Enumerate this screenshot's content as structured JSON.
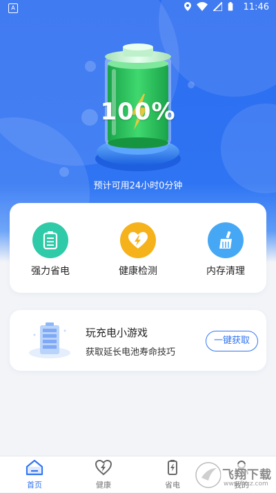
{
  "status_bar": {
    "time": "11:46",
    "left_icon": "A"
  },
  "battery": {
    "percent_text": "100%",
    "level": 100
  },
  "estimate": "预计可用24小时0分钟",
  "features": [
    {
      "label": "强力省电",
      "icon": "battery-save-icon",
      "color": "#2fcaa8"
    },
    {
      "label": "健康检测",
      "icon": "heart-bolt-icon",
      "color": "#f5b21b"
    },
    {
      "label": "内存清理",
      "icon": "broom-icon",
      "color": "#46a8f5"
    }
  ],
  "game": {
    "title": "玩充电小游戏",
    "subtitle": "获取延长电池寿命技巧",
    "button": "一键获取"
  },
  "tabs": [
    {
      "label": "首页",
      "icon": "home-icon",
      "active": true
    },
    {
      "label": "健康",
      "icon": "heart-icon",
      "active": false
    },
    {
      "label": "省电",
      "icon": "battery-icon",
      "active": false
    },
    {
      "label": "我的",
      "icon": "user-icon",
      "active": false
    }
  ],
  "watermark": {
    "text": "飞翔下载",
    "site": "www.fxxz.com"
  },
  "colors": {
    "primary": "#2f74f3",
    "battery_green": "#22c25a"
  }
}
